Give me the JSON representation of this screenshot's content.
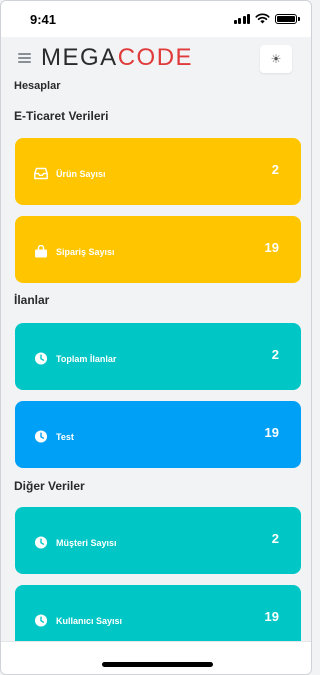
{
  "status_bar": {
    "time": "9:41"
  },
  "header": {
    "logo_part1": "MEGA",
    "logo_part2": "CODE",
    "theme_icon": "☀",
    "colors": {
      "logo_dark": "#2b2b2b",
      "logo_accent": "#e03b3b"
    }
  },
  "page": {
    "title": "Hesaplar"
  },
  "sections": [
    {
      "title": "E-Ticaret Verileri",
      "cards": [
        {
          "label": "Ürün Sayısı",
          "value": "2",
          "color": "#ffc600",
          "icon": "inbox-icon"
        },
        {
          "label": "Sipariş Sayısı",
          "value": "19",
          "color": "#ffc600",
          "icon": "shopping-bag-icon"
        }
      ]
    },
    {
      "title": "İlanlar",
      "cards": [
        {
          "label": "Toplam İlanlar",
          "value": "2",
          "color": "#00c6c6",
          "icon": "clock-icon"
        },
        {
          "label": "Test",
          "value": "19",
          "color": "#00a0f6",
          "icon": "clock-icon"
        }
      ]
    },
    {
      "title": "Diğer Veriler",
      "cards": [
        {
          "label": "Müşteri Sayısı",
          "value": "2",
          "color": "#00c6c6",
          "icon": "clock-icon"
        },
        {
          "label": "Kullanıcı Sayısı",
          "value": "19",
          "color": "#00c6c6",
          "icon": "clock-icon"
        }
      ]
    }
  ]
}
